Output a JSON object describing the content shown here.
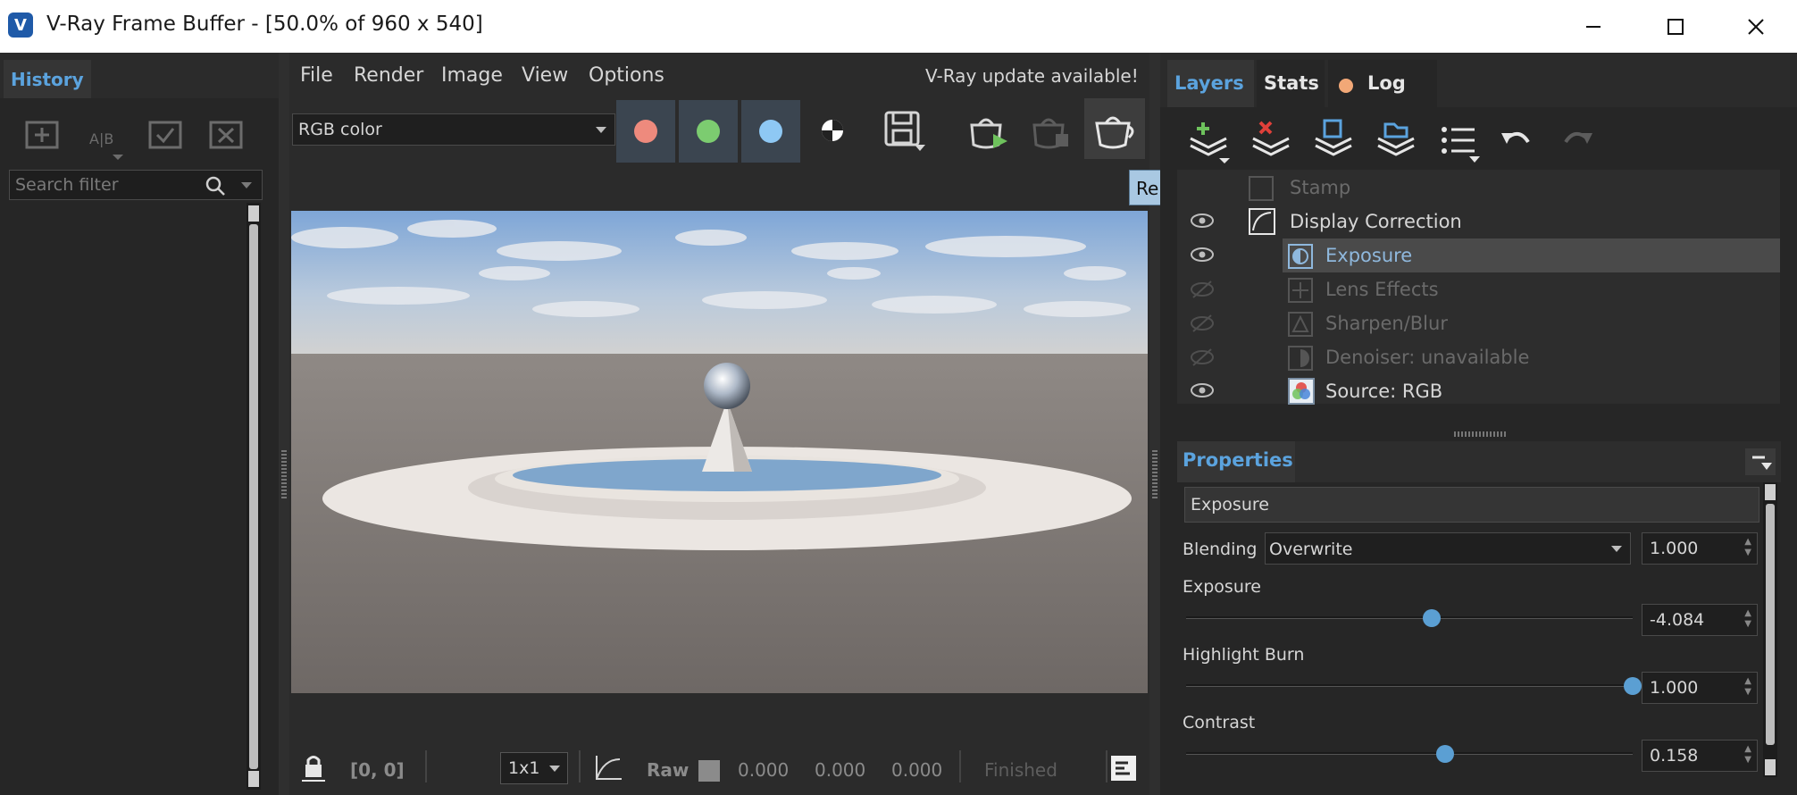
{
  "window": {
    "title": "V-Ray Frame Buffer - [50.0% of 960 x 540]",
    "logo_letter": "V"
  },
  "history": {
    "tab": "History",
    "search_placeholder": "Search filter"
  },
  "menu": {
    "items": [
      "File",
      "Render",
      "Image",
      "View",
      "Options"
    ],
    "update_notice": "V-Ray update available!"
  },
  "toolbar": {
    "channel": "RGB color",
    "tooltip": "Render",
    "colors": {
      "red": "#ee8a7d",
      "green": "#7ccc70",
      "blue": "#8ec8f4"
    }
  },
  "statusbar": {
    "coords": "[0, 0]",
    "zoom": "1x1",
    "raw_label": "Raw",
    "values": [
      "0.000",
      "0.000",
      "0.000"
    ],
    "status": "Finished"
  },
  "layers_panel": {
    "tabs": [
      "Layers",
      "Stats",
      "Log"
    ],
    "layers": [
      {
        "label": "Stamp",
        "visible": false,
        "indent": 0,
        "dim": true
      },
      {
        "label": "Display Correction",
        "visible": true,
        "indent": 0,
        "dim": false
      },
      {
        "label": "Exposure",
        "visible": true,
        "indent": 1,
        "dim": false,
        "selected": true
      },
      {
        "label": "Lens Effects",
        "visible": false,
        "indent": 1,
        "dim": true
      },
      {
        "label": "Sharpen/Blur",
        "visible": false,
        "indent": 1,
        "dim": true
      },
      {
        "label": "Denoiser: unavailable",
        "visible": false,
        "indent": 1,
        "dim": true
      },
      {
        "label": "Source: RGB",
        "visible": true,
        "indent": 1,
        "dim": false
      }
    ]
  },
  "properties": {
    "header": "Properties",
    "name": "Exposure",
    "blending_label": "Blending",
    "blending_mode": "Overwrite",
    "blending_value": "1.000",
    "exposure_label": "Exposure",
    "exposure_value": "-4.084",
    "exposure_level": 0.55,
    "highlight_label": "Highlight Burn",
    "highlight_value": "1.000",
    "highlight_level": 1.0,
    "contrast_label": "Contrast",
    "contrast_value": "0.158",
    "contrast_level": 0.58
  }
}
